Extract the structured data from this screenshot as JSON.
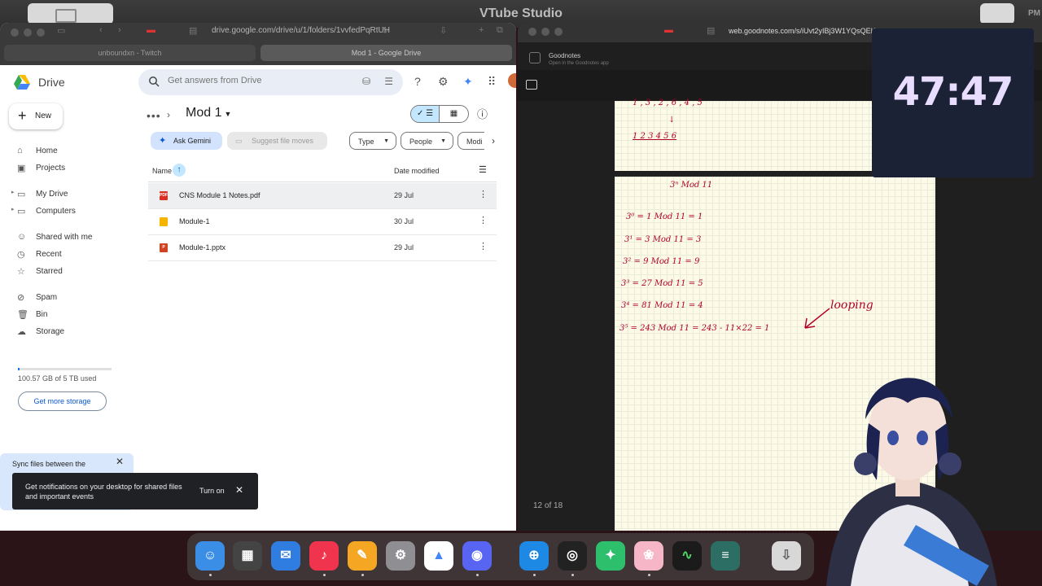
{
  "title_bar": {
    "title": "VTube Studio"
  },
  "left_browser": {
    "url": "drive.google.com/drive/u/1/folders/1vvfedPqRtUH",
    "tabs": [
      {
        "label": "unboundxn - Twitch"
      },
      {
        "label": "Mod 1 - Google Drive"
      }
    ]
  },
  "drive": {
    "app_name": "Drive",
    "search_placeholder": "Get answers from Drive",
    "new_label": "New",
    "nav": [
      {
        "label": "Home",
        "icon": "home-icon"
      },
      {
        "label": "Projects",
        "icon": "projects-icon"
      },
      {
        "label": "My Drive",
        "icon": "drive-icon"
      },
      {
        "label": "Computers",
        "icon": "computer-icon"
      },
      {
        "label": "Shared with me",
        "icon": "shared-icon"
      },
      {
        "label": "Recent",
        "icon": "clock-icon"
      },
      {
        "label": "Starred",
        "icon": "star-icon"
      },
      {
        "label": "Spam",
        "icon": "spam-icon"
      },
      {
        "label": "Bin",
        "icon": "bin-icon"
      },
      {
        "label": "Storage",
        "icon": "cloud-icon"
      }
    ],
    "storage_text": "100.57 GB of 5 TB used",
    "get_more_storage": "Get more storage",
    "breadcrumb_title": "Mod 1",
    "ask_gemini": "Ask Gemini",
    "suggest_moves": "Suggest file moves",
    "filters": [
      "Type",
      "People",
      "Modi"
    ],
    "columns": {
      "name": "Name",
      "date": "Date modified"
    },
    "files": [
      {
        "name": "CNS Module 1 Notes.pdf",
        "date": "29 Jul",
        "icon": "pdf-icon",
        "color": "#d93025",
        "tag": "PDF"
      },
      {
        "name": "Module-1",
        "date": "30 Jul",
        "icon": "slides-icon",
        "color": "#f4b400",
        "tag": ""
      },
      {
        "name": "Module-1.pptx",
        "date": "29 Jul",
        "icon": "pptx-icon",
        "color": "#d04423",
        "tag": "P"
      }
    ],
    "sync_text": "Sync files between the",
    "toast": {
      "message": "Get notifications on your desktop for shared files and important events",
      "action": "Turn on"
    }
  },
  "goodnotes": {
    "url": "web.goodnotes.com/s/iUvt2yIBj3W1YQsQEK",
    "app_name": "Goodnotes",
    "app_sub": "Open in the Goodnotes app",
    "page_count": "12 of 18",
    "notes_top": [
      "1 , 3 , 2 , 6 , 4 , 5",
      "↓",
      "1 2 3 4 5 6"
    ],
    "notes": [
      "3ⁿ Mod 11",
      "3⁰ = 1 Mod 11 = 1",
      "3¹ = 3 Mod 11 = 3",
      "3² = 9 Mod 11 = 9",
      "3³ = 27 Mod 11 = 5",
      "3⁴ = 81 Mod 11 = 4",
      "3⁵ = 243 Mod 11 = 243 - 11×22 = 1"
    ],
    "annotation": "looping"
  },
  "timer": {
    "value": "47:47"
  },
  "dock": [
    {
      "name": "finder-icon",
      "color": "#3a8ee6",
      "glyph": "☺"
    },
    {
      "name": "launchpad-icon",
      "color": "#444",
      "glyph": "▦"
    },
    {
      "name": "mail-icon",
      "color": "#2f7de1",
      "glyph": "✉"
    },
    {
      "name": "music-icon",
      "color": "#f0344e",
      "glyph": "♪"
    },
    {
      "name": "pages-icon",
      "color": "#f5a623",
      "glyph": "✎"
    },
    {
      "name": "settings-icon",
      "color": "#8e8e93",
      "glyph": "⚙"
    },
    {
      "name": "drive-app-icon",
      "color": "#fff",
      "glyph": "▲"
    },
    {
      "name": "discord-icon",
      "color": "#5865f2",
      "glyph": "◉"
    },
    {
      "name": "safari-icon",
      "color": "#1e88e5",
      "glyph": "⊕"
    },
    {
      "name": "obs-icon",
      "color": "#222",
      "glyph": "◎"
    },
    {
      "name": "chat-icon",
      "color": "#2dbf6c",
      "glyph": "✦"
    },
    {
      "name": "vtube-icon",
      "color": "#f6b6c8",
      "glyph": "❀"
    },
    {
      "name": "monitor-icon",
      "color": "#1b1b1b",
      "glyph": "∿"
    },
    {
      "name": "script-icon",
      "color": "#2c6e63",
      "glyph": "≡"
    },
    {
      "name": "downloads-icon",
      "color": "#d8d8d8",
      "glyph": "⇩"
    }
  ]
}
